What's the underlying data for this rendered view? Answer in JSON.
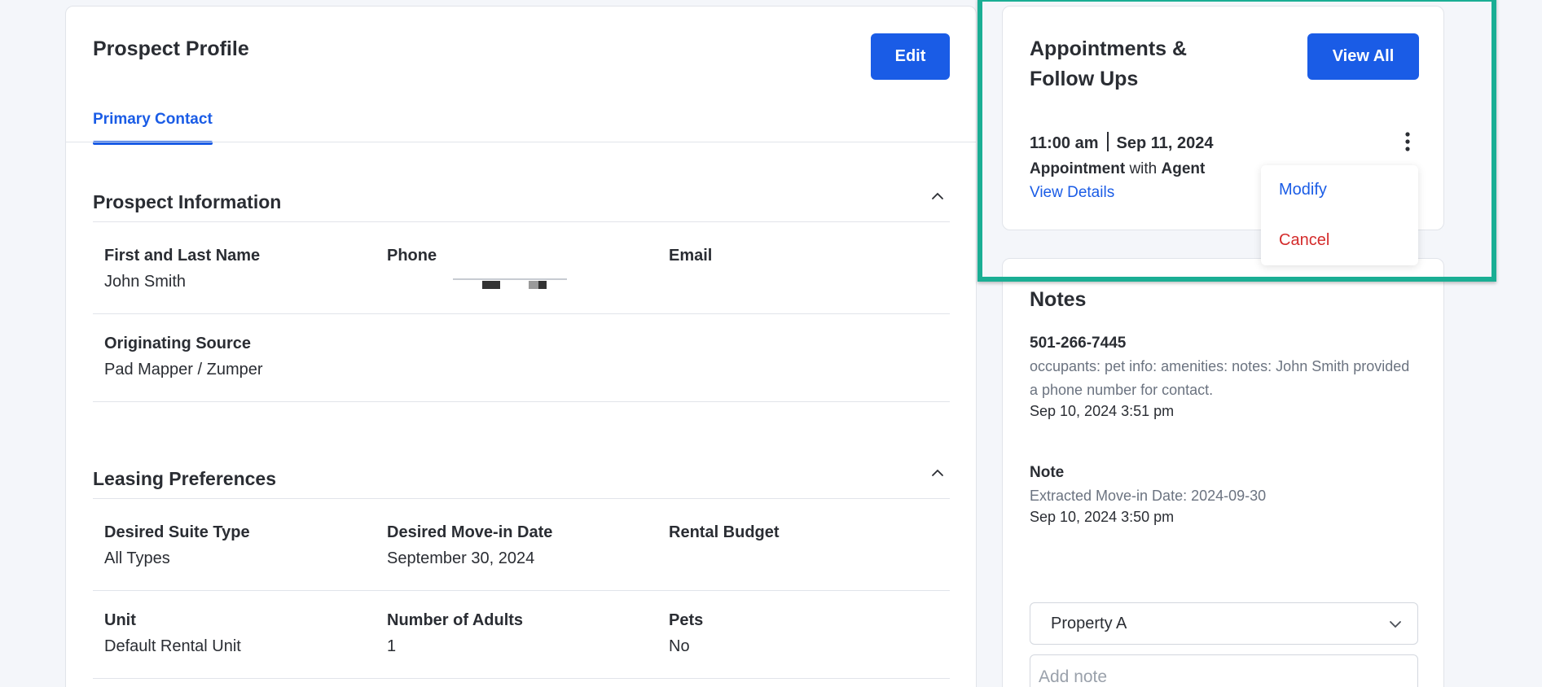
{
  "colors": {
    "accent": "#1a5ce6",
    "danger": "#d42b2b",
    "highlight": "#1aae94",
    "page_bg": "#f4f6fa"
  },
  "profile": {
    "title": "Prospect Profile",
    "edit_label": "Edit",
    "tabs": [
      {
        "label": "Primary Contact",
        "active": true
      }
    ],
    "sections": {
      "prospect_info": {
        "title": "Prospect Information",
        "fields": [
          {
            "label": "First and Last Name",
            "value": "John Smith"
          },
          {
            "label": "Phone",
            "value": ""
          },
          {
            "label": "Email",
            "value": ""
          },
          {
            "label": "Originating Source",
            "value": "Pad Mapper / Zumper"
          }
        ]
      },
      "leasing_prefs": {
        "title": "Leasing Preferences",
        "fields": [
          {
            "label": "Desired Suite Type",
            "value": "All Types"
          },
          {
            "label": "Desired Move-in Date",
            "value": "September 30, 2024"
          },
          {
            "label": "Rental Budget",
            "value": ""
          },
          {
            "label": "Unit",
            "value": "Default Rental Unit"
          },
          {
            "label": "Number of Adults",
            "value": "1"
          },
          {
            "label": "Pets",
            "value": "No"
          }
        ]
      }
    }
  },
  "appointments": {
    "title": "Appointments & Follow Ups",
    "view_all_label": "View All",
    "item": {
      "time": "11:00 am",
      "date": "Sep 11, 2024",
      "type": "Appointment",
      "with_text": "with",
      "agent": "Agent",
      "view_details_label": "View Details"
    },
    "menu": {
      "modify": "Modify",
      "cancel": "Cancel"
    }
  },
  "notes": {
    "title": "Notes",
    "items": [
      {
        "title": "501-266-7445",
        "body": "occupants: pet info: amenities: notes: John Smith provided a phone number for contact.",
        "timestamp": "Sep 10, 2024 3:51 pm"
      },
      {
        "title": "Note",
        "body": "Extracted Move-in Date: 2024-09-30",
        "timestamp": "Sep 10, 2024 3:50 pm"
      }
    ],
    "property_select": {
      "value": "Property A"
    },
    "add_note": {
      "placeholder": "Add note"
    }
  }
}
